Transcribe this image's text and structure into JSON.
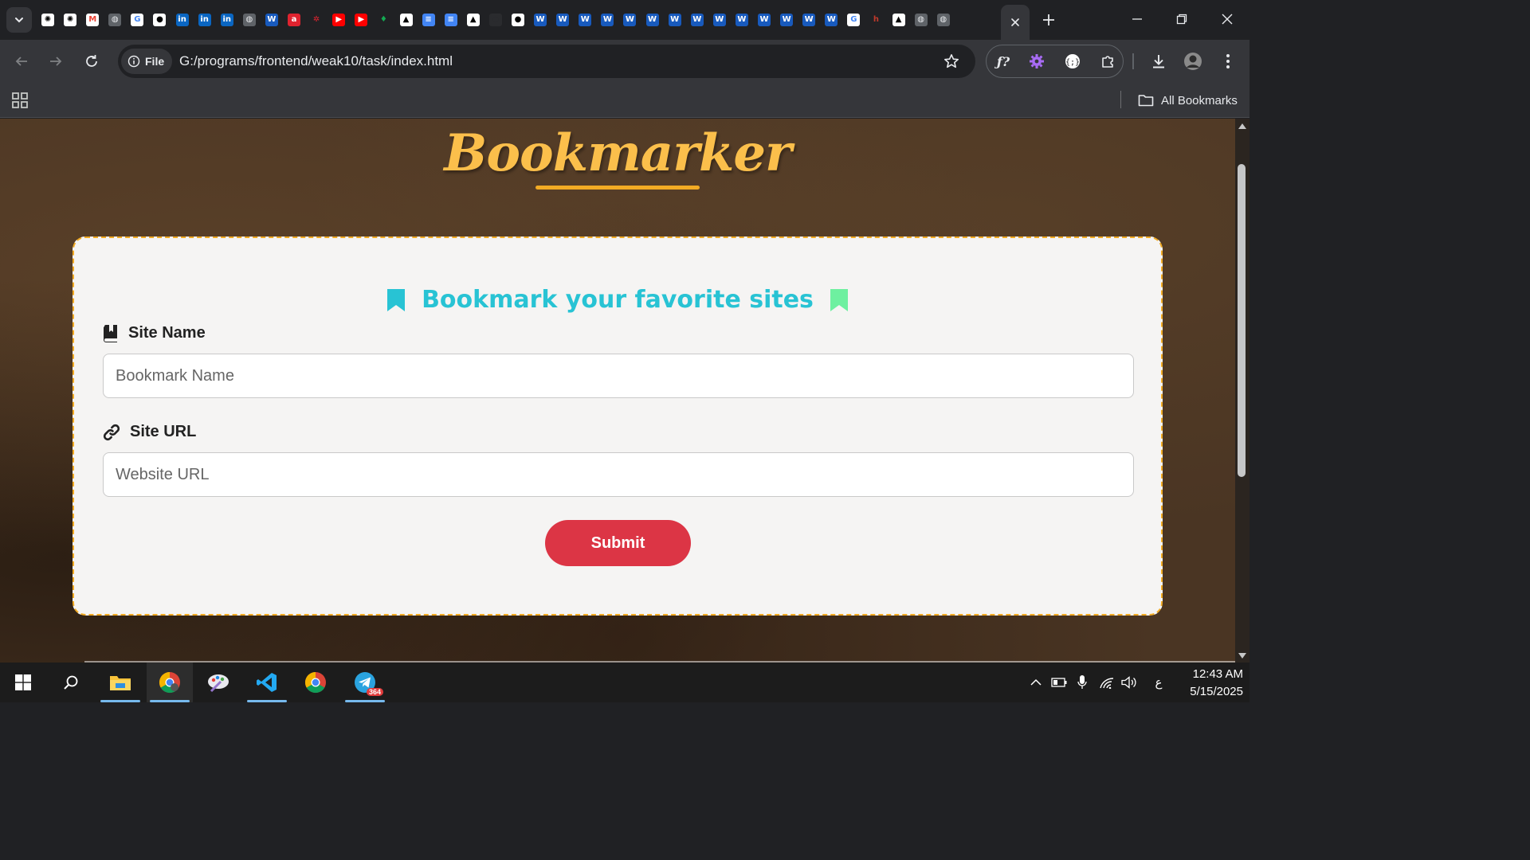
{
  "browser": {
    "address": {
      "scheme_label": "File",
      "url": "G:/programs/frontend/weak10/task/index.html"
    },
    "bookmarks_bar": {
      "all_bookmarks_label": "All Bookmarks"
    },
    "pinned_favicons": [
      {
        "name": "chatgpt",
        "bg": "#ffffff",
        "fg": "#000000",
        "glyph": "✺"
      },
      {
        "name": "chatgpt-2",
        "bg": "#ffffff",
        "fg": "#000000",
        "glyph": "✺"
      },
      {
        "name": "gmail",
        "bg": "#ffffff",
        "fg": "#ea4335",
        "glyph": "M"
      },
      {
        "name": "globe",
        "bg": "#5f6368",
        "fg": "#e8eaed",
        "glyph": "◍"
      },
      {
        "name": "google",
        "bg": "#ffffff",
        "fg": "#4285f4",
        "glyph": "G"
      },
      {
        "name": "github",
        "bg": "#ffffff",
        "fg": "#000000",
        "glyph": "●"
      },
      {
        "name": "linkedin",
        "bg": "#0a66c2",
        "fg": "#ffffff",
        "glyph": "in"
      },
      {
        "name": "linkedin-2",
        "bg": "#0a66c2",
        "fg": "#ffffff",
        "glyph": "in"
      },
      {
        "name": "linkedin-3",
        "bg": "#0a66c2",
        "fg": "#ffffff",
        "glyph": "in"
      },
      {
        "name": "globe-2",
        "bg": "#5f6368",
        "fg": "#e8eaed",
        "glyph": "◍"
      },
      {
        "name": "word",
        "bg": "#185abd",
        "fg": "#ffffff",
        "glyph": "W"
      },
      {
        "name": "app-red",
        "bg": "#e0232f",
        "fg": "#ffffff",
        "glyph": "a"
      },
      {
        "name": "octopus",
        "bg": "#202124",
        "fg": "#e0232f",
        "glyph": "✲"
      },
      {
        "name": "youtube",
        "bg": "#ff0000",
        "fg": "#ffffff",
        "glyph": "▶"
      },
      {
        "name": "youtube-2",
        "bg": "#ff0000",
        "fg": "#ffffff",
        "glyph": "▶"
      },
      {
        "name": "leaf",
        "bg": "#202124",
        "fg": "#13aa52",
        "glyph": "♦"
      },
      {
        "name": "notion-triangle",
        "bg": "#ffffff",
        "fg": "#000000",
        "glyph": "▲"
      },
      {
        "name": "docs",
        "bg": "#4285f4",
        "fg": "#ffffff",
        "glyph": "≡"
      },
      {
        "name": "docs-2",
        "bg": "#4285f4",
        "fg": "#ffffff",
        "glyph": "≡"
      },
      {
        "name": "triangle",
        "bg": "#ffffff",
        "fg": "#000000",
        "glyph": "▲"
      },
      {
        "name": "blank",
        "bg": "#2a2b2e",
        "fg": "#2a2b2e",
        "glyph": "○"
      },
      {
        "name": "github-2",
        "bg": "#ffffff",
        "fg": "#000000",
        "glyph": "●"
      },
      {
        "name": "word-2",
        "bg": "#185abd",
        "fg": "#ffffff",
        "glyph": "W"
      },
      {
        "name": "word-3",
        "bg": "#185abd",
        "fg": "#ffffff",
        "glyph": "W"
      },
      {
        "name": "word-4",
        "bg": "#185abd",
        "fg": "#ffffff",
        "glyph": "W"
      },
      {
        "name": "word-5",
        "bg": "#185abd",
        "fg": "#ffffff",
        "glyph": "W"
      },
      {
        "name": "word-6",
        "bg": "#185abd",
        "fg": "#ffffff",
        "glyph": "W"
      },
      {
        "name": "word-7",
        "bg": "#185abd",
        "fg": "#ffffff",
        "glyph": "W"
      },
      {
        "name": "word-8",
        "bg": "#185abd",
        "fg": "#ffffff",
        "glyph": "W"
      },
      {
        "name": "word-9",
        "bg": "#185abd",
        "fg": "#ffffff",
        "glyph": "W"
      },
      {
        "name": "word-10",
        "bg": "#185abd",
        "fg": "#ffffff",
        "glyph": "W"
      },
      {
        "name": "word-11",
        "bg": "#185abd",
        "fg": "#ffffff",
        "glyph": "W"
      },
      {
        "name": "word-12",
        "bg": "#185abd",
        "fg": "#ffffff",
        "glyph": "W"
      },
      {
        "name": "word-13",
        "bg": "#185abd",
        "fg": "#ffffff",
        "glyph": "W"
      },
      {
        "name": "word-14",
        "bg": "#185abd",
        "fg": "#ffffff",
        "glyph": "W"
      },
      {
        "name": "word-15",
        "bg": "#185abd",
        "fg": "#ffffff",
        "glyph": "W"
      },
      {
        "name": "google-2",
        "bg": "#ffffff",
        "fg": "#4285f4",
        "glyph": "G"
      },
      {
        "name": "app-red-2",
        "bg": "#202124",
        "fg": "#c0392b",
        "glyph": "h"
      },
      {
        "name": "triangle-2",
        "bg": "#ffffff",
        "fg": "#000000",
        "glyph": "▲"
      },
      {
        "name": "globe-3",
        "bg": "#5f6368",
        "fg": "#e8eaed",
        "glyph": "◍"
      },
      {
        "name": "globe-4",
        "bg": "#5f6368",
        "fg": "#e8eaed",
        "glyph": "◍"
      }
    ]
  },
  "page": {
    "brand": "Bookmarker",
    "card_title": "Bookmark your favorite sites",
    "site_name": {
      "label": "Site Name",
      "placeholder": "Bookmark Name",
      "value": ""
    },
    "site_url": {
      "label": "Site URL",
      "placeholder": "Website URL",
      "value": ""
    },
    "submit_label": "Submit"
  },
  "colors": {
    "brand": "#fbbf4b",
    "accent_border": "#f2ab24",
    "title_cyan": "#28c3d4",
    "bookmark_green": "#6ef0a0",
    "submit_red": "#dc3545"
  },
  "taskbar": {
    "time": "12:43 AM",
    "date": "5/15/2025",
    "telegram_badge": "364",
    "input_indicator": "ع"
  }
}
